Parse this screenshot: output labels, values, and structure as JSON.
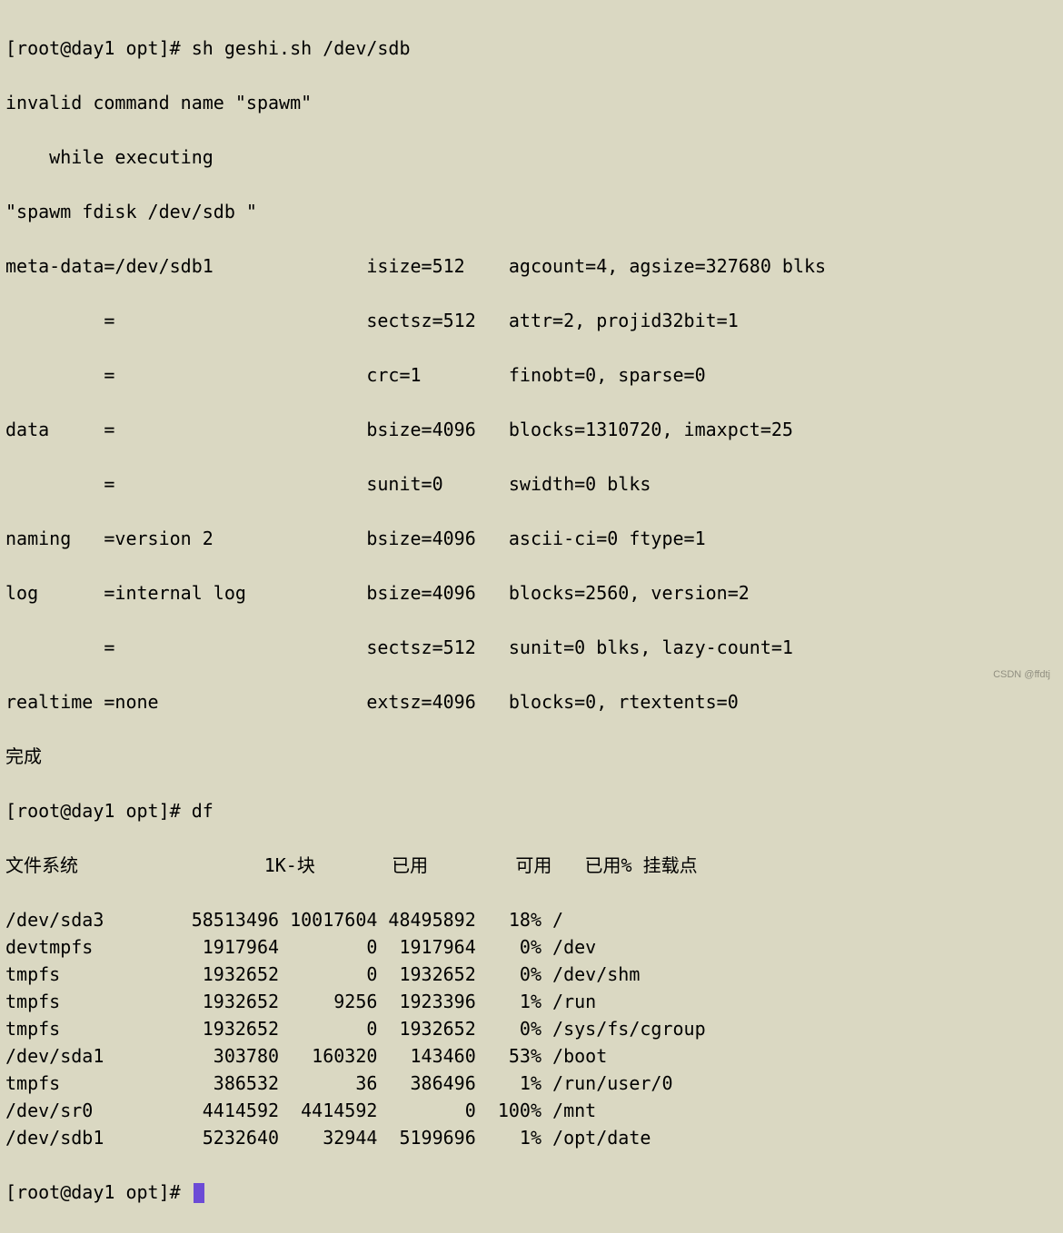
{
  "prompt1": "[root@day1 opt]# sh geshi.sh /dev/sdb",
  "err1": "invalid command name \"spawm\"",
  "err2": "    while executing",
  "err3": "\"spawm fdisk /dev/sdb \"",
  "mkfs": {
    "l1": "meta-data=/dev/sdb1              isize=512    agcount=4, agsize=327680 blks",
    "l2": "         =                       sectsz=512   attr=2, projid32bit=1",
    "l3": "         =                       crc=1        finobt=0, sparse=0",
    "l4": "data     =                       bsize=4096   blocks=1310720, imaxpct=25",
    "l5": "         =                       sunit=0      swidth=0 blks",
    "l6": "naming   =version 2              bsize=4096   ascii-ci=0 ftype=1",
    "l7": "log      =internal log           bsize=4096   blocks=2560, version=2",
    "l8": "         =                       sectsz=512   sunit=0 blks, lazy-count=1",
    "l9": "realtime =none                   extsz=4096   blocks=0, rtextents=0"
  },
  "done": "完成",
  "prompt2": "[root@day1 opt]# df",
  "df": {
    "header": {
      "fs": "文件系统",
      "sz": "1K-块",
      "used": "已用",
      "avail": "可用",
      "pct": "已用%",
      "mnt": "挂载点"
    },
    "rows": [
      {
        "fs": "/dev/sda3",
        "sz": "58513496",
        "used": "10017604",
        "avail": "48495892",
        "pct": "18%",
        "mnt": "/"
      },
      {
        "fs": "devtmpfs",
        "sz": "1917964",
        "used": "0",
        "avail": "1917964",
        "pct": "0%",
        "mnt": "/dev"
      },
      {
        "fs": "tmpfs",
        "sz": "1932652",
        "used": "0",
        "avail": "1932652",
        "pct": "0%",
        "mnt": "/dev/shm"
      },
      {
        "fs": "tmpfs",
        "sz": "1932652",
        "used": "9256",
        "avail": "1923396",
        "pct": "1%",
        "mnt": "/run"
      },
      {
        "fs": "tmpfs",
        "sz": "1932652",
        "used": "0",
        "avail": "1932652",
        "pct": "0%",
        "mnt": "/sys/fs/cgroup"
      },
      {
        "fs": "/dev/sda1",
        "sz": "303780",
        "used": "160320",
        "avail": "143460",
        "pct": "53%",
        "mnt": "/boot"
      },
      {
        "fs": "tmpfs",
        "sz": "386532",
        "used": "36",
        "avail": "386496",
        "pct": "1%",
        "mnt": "/run/user/0"
      },
      {
        "fs": "/dev/sr0",
        "sz": "4414592",
        "used": "4414592",
        "avail": "0",
        "pct": "100%",
        "mnt": "/mnt"
      },
      {
        "fs": "/dev/sdb1",
        "sz": "5232640",
        "used": "32944",
        "avail": "5199696",
        "pct": "1%",
        "mnt": "/opt/date"
      }
    ]
  },
  "prompt3": "[root@day1 opt]# ",
  "watermark": "CSDN @ffdtj",
  "chart_data": {
    "type": "table",
    "title": "df output",
    "columns": [
      "文件系统",
      "1K-块",
      "已用",
      "可用",
      "已用%",
      "挂载点"
    ],
    "rows": [
      [
        "/dev/sda3",
        58513496,
        10017604,
        48495892,
        "18%",
        "/"
      ],
      [
        "devtmpfs",
        1917964,
        0,
        1917964,
        "0%",
        "/dev"
      ],
      [
        "tmpfs",
        1932652,
        0,
        1932652,
        "0%",
        "/dev/shm"
      ],
      [
        "tmpfs",
        1932652,
        9256,
        1923396,
        "1%",
        "/run"
      ],
      [
        "tmpfs",
        1932652,
        0,
        1932652,
        "0%",
        "/sys/fs/cgroup"
      ],
      [
        "/dev/sda1",
        303780,
        160320,
        143460,
        "53%",
        "/boot"
      ],
      [
        "tmpfs",
        386532,
        36,
        386496,
        "1%",
        "/run/user/0"
      ],
      [
        "/dev/sr0",
        4414592,
        4414592,
        0,
        "100%",
        "/mnt"
      ],
      [
        "/dev/sdb1",
        5232640,
        32944,
        5199696,
        "1%",
        "/opt/date"
      ]
    ]
  }
}
